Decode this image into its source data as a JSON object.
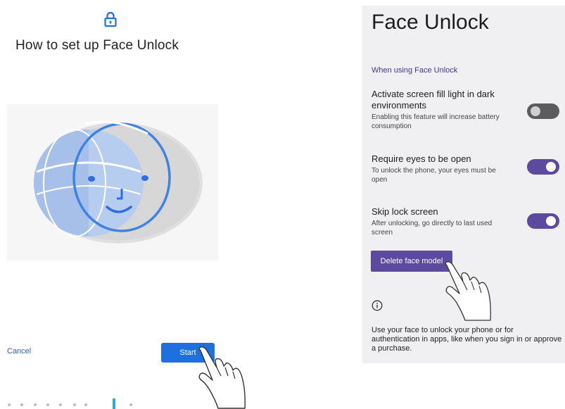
{
  "left_screen": {
    "title": "How to set up Face Unlock",
    "cancel_label": "Cancel",
    "start_label": "Start",
    "lock_icon": "lock-icon",
    "face_illustration": "face-scan-illustration"
  },
  "right_screen": {
    "title": "Face Unlock",
    "section_header": "When using Face Unlock",
    "settings": [
      {
        "title": "Activate screen fill light in dark environments",
        "description": "Enabling this feature will increase battery consumption",
        "enabled": false
      },
      {
        "title": "Require eyes to be open",
        "description": "To unlock the phone, your eyes must be open",
        "enabled": true
      },
      {
        "title": "Skip lock screen",
        "description": "After unlocking, go directly to last used screen",
        "enabled": true
      }
    ],
    "delete_label": "Delete face model",
    "info_icon": "info-icon",
    "info_text": "Use your face to unlock your phone or for authentication in apps, like when you sign in or approve a purchase."
  },
  "colors": {
    "accent_purple": "#5b4aa0",
    "start_blue": "#1e6fe0",
    "toggle_off": "#5c5c5c",
    "cancel_blue": "#2a5fc2"
  }
}
